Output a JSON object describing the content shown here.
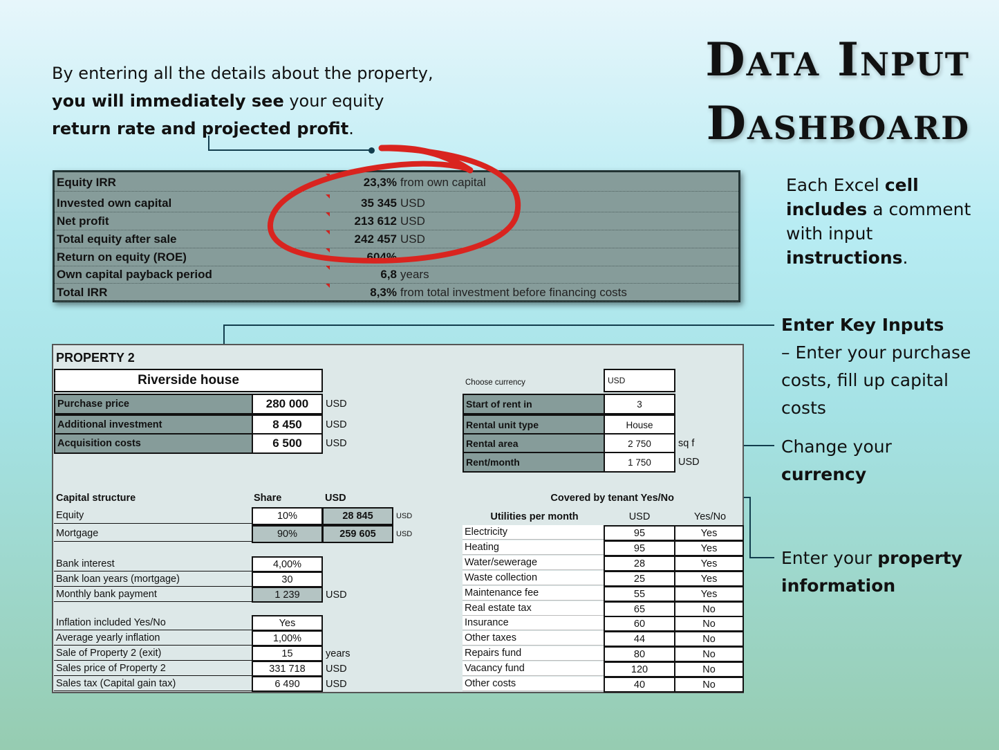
{
  "title": {
    "line1": "Data Input",
    "line2": "Dashboard"
  },
  "intro": {
    "t1": "By entering all the details about the property, ",
    "b1": "you will immediately see",
    "t2": " your equity ",
    "b2": "return rate and projected profit",
    "t3": "."
  },
  "note_cell": {
    "t1": "Each Excel ",
    "b1": "cell includes",
    "t2": " a comment with input ",
    "b2": "instructions",
    "t3": "."
  },
  "note_inputs": {
    "b1": "Enter Key Inputs",
    "t1": "– Enter your purchase costs, fill up capital costs"
  },
  "note_currency": {
    "t1": "Change your ",
    "b1": "currency"
  },
  "note_property": {
    "t1": "Enter your ",
    "b1": "property information"
  },
  "summary": [
    {
      "label": "Equity IRR",
      "value": "23,3%",
      "unit": "from own capital"
    },
    {
      "label": "Invested own capital",
      "value": "35 345",
      "unit": "USD"
    },
    {
      "label": "Net profit",
      "value": "213 612",
      "unit": "USD"
    },
    {
      "label": "Total equity after sale",
      "value": "242 457",
      "unit": "USD"
    },
    {
      "label": "Return on equity (ROE)",
      "value": "604%",
      "unit": ""
    },
    {
      "label": "Own capital payback period",
      "value": "6,8",
      "unit": "years"
    },
    {
      "label": "Total IRR",
      "value": "8,3%",
      "unit": "from total investment before financing costs"
    }
  ],
  "sheet": {
    "heading": "PROPERTY 2",
    "property_name": "Riverside house",
    "purchase": [
      {
        "label": "Purchase price",
        "value": "280 000",
        "unit": "USD"
      },
      {
        "label": "Additional investment",
        "value": "8 450",
        "unit": "USD"
      },
      {
        "label": "Acquisition costs",
        "value": "6 500",
        "unit": "USD"
      }
    ],
    "currency_label": "Choose currency",
    "currency_value": "USD",
    "rent": [
      {
        "label": "Start of rent in",
        "value": "3",
        "unit": ""
      },
      {
        "label": "Rental unit type",
        "value": "House",
        "unit": ""
      },
      {
        "label": "Rental area",
        "value": "2 750",
        "unit": "sq f"
      },
      {
        "label": "Rent/month",
        "value": "1 750",
        "unit": "USD"
      }
    ],
    "capital": {
      "header": "Capital structure",
      "share_header": "Share",
      "usd_header": "USD",
      "rows": [
        {
          "label": "Equity",
          "share": "10%",
          "usd": "28 845",
          "unit": "USD"
        },
        {
          "label": "Mortgage",
          "share": "90%",
          "usd": "259 605",
          "unit": "USD"
        }
      ]
    },
    "bank": [
      {
        "label": "Bank interest",
        "value": "4,00%",
        "unit": ""
      },
      {
        "label": "Bank loan years (mortgage)",
        "value": "30",
        "unit": ""
      },
      {
        "label": "Monthly bank payment",
        "value": "1 239",
        "unit": "USD"
      }
    ],
    "exit": [
      {
        "label": "Inflation included Yes/No",
        "value": "Yes",
        "unit": ""
      },
      {
        "label": "Average yearly inflation",
        "value": "1,00%",
        "unit": ""
      },
      {
        "label": "Sale of Property 2 (exit)",
        "value": "15",
        "unit": "years"
      },
      {
        "label": "Sales price of Property 2",
        "value": "331 718",
        "unit": "USD"
      },
      {
        "label": "Sales tax (Capital gain tax)",
        "value": "6 490",
        "unit": "USD"
      }
    ],
    "utilities": {
      "covered_label": "Covered by tenant Yes/No",
      "header": "Utilities per month",
      "usd_header": "USD",
      "yn_header": "Yes/No",
      "rows": [
        {
          "label": "Electricity",
          "usd": "95",
          "yn": "Yes"
        },
        {
          "label": "Heating",
          "usd": "95",
          "yn": "Yes"
        },
        {
          "label": "Water/sewerage",
          "usd": "28",
          "yn": "Yes"
        },
        {
          "label": "Waste collection",
          "usd": "25",
          "yn": "Yes"
        },
        {
          "label": "Maintenance fee",
          "usd": "55",
          "yn": "Yes"
        },
        {
          "label": "Real estate tax",
          "usd": "65",
          "yn": "No"
        },
        {
          "label": "Insurance",
          "usd": "60",
          "yn": "No"
        },
        {
          "label": "Other taxes",
          "usd": "44",
          "yn": "No"
        },
        {
          "label": "Repairs fund",
          "usd": "80",
          "yn": "No"
        },
        {
          "label": "Vacancy fund",
          "usd": "120",
          "yn": "No"
        },
        {
          "label": "Other costs",
          "usd": "40",
          "yn": "No"
        }
      ]
    }
  },
  "colors": {
    "accent_red": "#d9241f",
    "panel_gray": "#869c9a",
    "connector": "#123d4d"
  }
}
